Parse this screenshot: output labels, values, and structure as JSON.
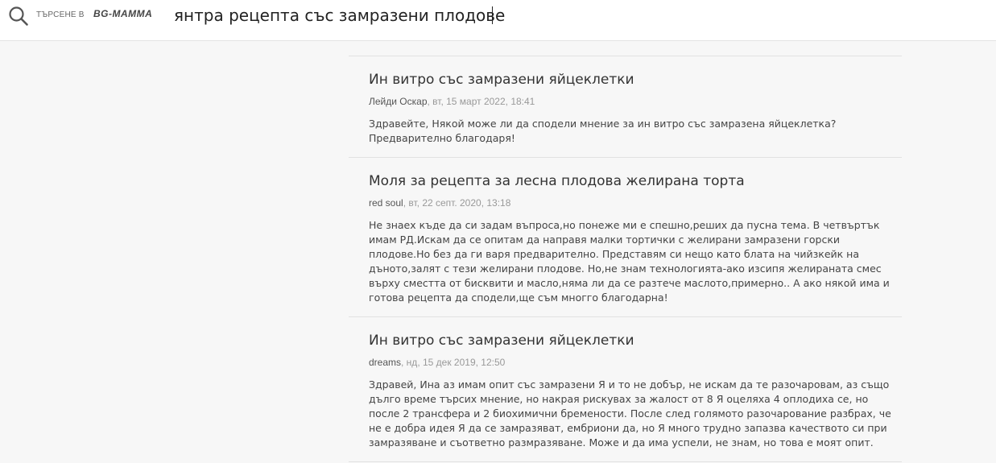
{
  "search": {
    "prefix": "ТЪРСЕНЕ В",
    "brand": "BG-MAMMA",
    "query": "янтра рецепта със замразени плодове"
  },
  "results": [
    {
      "title": "Ин витро със замразени яйцеклетки",
      "author": "Лейди Оскар",
      "date": ", вт, 15 март 2022, 18:41",
      "snippet": "Здравейте, Някой може ли да сподели мнение за ин витро със замразена яйцеклетка? Предварително благодаря!"
    },
    {
      "title": "Моля за рецепта за лесна плодова желирана торта",
      "author": "red soul",
      "date": ", вт, 22 септ. 2020, 13:18",
      "snippet": "Не знаех къде да си задам въпроса,но понеже ми е спешно,реших да пусна тема. В четвъртък имам РД.Искам да се опитам да направя малки тортички с желирани замразени горски плодове.Но без да ги варя предварително. Представям си нещо като блата на чийзкейк на дъното,залят с тези желирани плодове. Но,не знам технологията-ако изсипя желираната смес върху сместта от бисквити и масло,няма ли да се разтече маслото,примерно.. А ако някой има и готова рецепта да сподели,ще съм многго благодарна!"
    },
    {
      "title": "Ин витро със замразени яйцеклетки",
      "author": "dreams",
      "date": ", нд, 15 дек 2019, 12:50",
      "snippet": "Здравей, Ина аз имам опит със замразени Я и то не добър, не искам да те разочаровам, аз също дълго време търсих мнение, но накрая рискувах за жалост от 8 Я оцеляха 4 оплодиха се, но после 2 трансфера и 2 биохимични бремености. После след голямото разочарование разбрах, че не е добра идея Я да се замразяват, ембриони да, но Я много трудно запазва качеството си при замразяване и съответно размразяване. Може и да има успели, не знам, но това е моят опит."
    }
  ]
}
